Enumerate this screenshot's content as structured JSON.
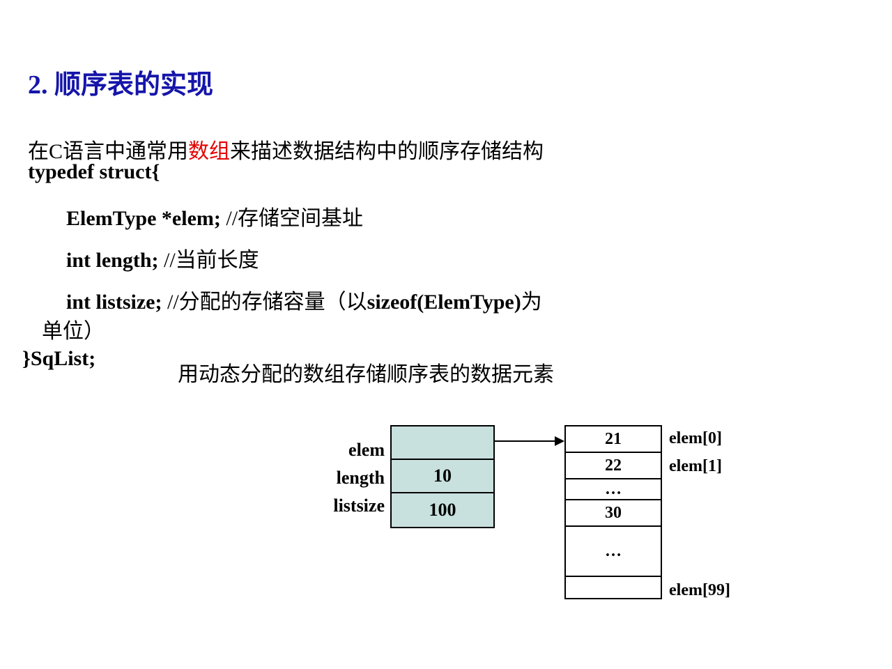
{
  "title": "2. 顺序表的实现",
  "intro": {
    "before": "在C语言中通常用",
    "highlight": "数组",
    "after": "来描述数据结构中的顺序存储结构"
  },
  "code": {
    "l1": "typedef  struct{",
    "l2_bold": "ElemType    *elem;",
    "l2_cmt": " //存储空间基址",
    "l3_bold": "int      length;",
    "l3_cmt": "  //当前长度",
    "l4_bold": "int      listsize;",
    "l4_cmt": " //分配的存储容量（以",
    "l4_sizeof": "sizeof(ElemType)",
    "l4_tail": "为",
    "l4b": "单位）",
    "l5": "}SqList;"
  },
  "subtitle": "用动态分配的数组存储顺序表的数据元素",
  "struct_labels": [
    "elem",
    "length",
    "listsize"
  ],
  "struct_vals": [
    "",
    "10",
    "100"
  ],
  "array_vals": [
    "21",
    "22",
    "…",
    "30",
    "…",
    ""
  ],
  "array_labels": [
    "elem[0]",
    "elem[1]",
    "elem[99]"
  ]
}
